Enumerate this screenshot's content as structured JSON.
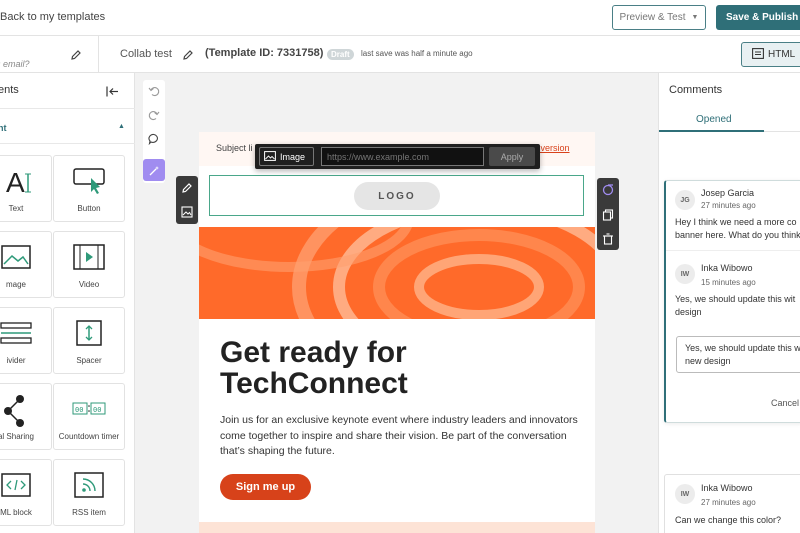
{
  "topbar": {
    "back_label": "Back to my templates",
    "preview_label": "Preview & Test",
    "publish_label": "Save & Publish to"
  },
  "subbar": {
    "email_hint": "s email?",
    "template_name": "Collab test",
    "template_id": "(Template ID: 7331758)",
    "status_badge": "Draft",
    "save_status": "last save was half a minute ago",
    "html_label": "HTML"
  },
  "left_panel": {
    "title": "ents",
    "section_label": "nt",
    "tiles": [
      {
        "label": "Text",
        "icon": "text-icon"
      },
      {
        "label": "Button",
        "icon": "button-cursor-icon"
      },
      {
        "label": "mage",
        "icon": "image-icon"
      },
      {
        "label": "Video",
        "icon": "video-icon"
      },
      {
        "label": "ivider",
        "icon": "divider-icon"
      },
      {
        "label": "Spacer",
        "icon": "spacer-icon"
      },
      {
        "label": "al Sharing",
        "icon": "share-icon"
      },
      {
        "label": "Countdown timer",
        "icon": "countdown-icon"
      },
      {
        "label": "ML block",
        "icon": "code-icon"
      },
      {
        "label": "RSS item",
        "icon": "rss-icon"
      }
    ]
  },
  "image_toolbar": {
    "type_label": "Image",
    "url_placeholder": "https://www.example.com",
    "apply_label": "Apply"
  },
  "email": {
    "subject_label": "Subject li",
    "web_version_link": "e version",
    "logo_text": "LOGO",
    "headline": "Get ready for TechConnect",
    "body": "Join us for an exclusive keynote event where industry leaders and innovators come together to inspire and share their vision. Be part of the conversation that’s shaping the future.",
    "cta_label": "Sign me up"
  },
  "comments": {
    "title": "Comments",
    "tab_opened": "Opened",
    "thread": [
      {
        "initials": "JG",
        "author": "Josep Garcia",
        "time": "27 minutes ago",
        "lines": [
          "Hey I think we need a more co",
          "banner here. What do you think"
        ]
      },
      {
        "initials": "IW",
        "author": "Inka Wibowo",
        "time": "15 minutes ago",
        "lines": [
          "Yes, we should update this wit",
          "design"
        ]
      }
    ],
    "reply_lines": [
      "Yes, we should update this w",
      "new design"
    ],
    "cancel_label": "Cancel",
    "second": {
      "initials": "IW",
      "author": "Inka Wibowo",
      "time": "27 minutes ago",
      "text": "Can we change this color?"
    }
  },
  "colors": {
    "brand": "#2f6f78",
    "cta": "#d7421a",
    "hero": "#ff6a2a",
    "magic": "#a08cf0"
  }
}
